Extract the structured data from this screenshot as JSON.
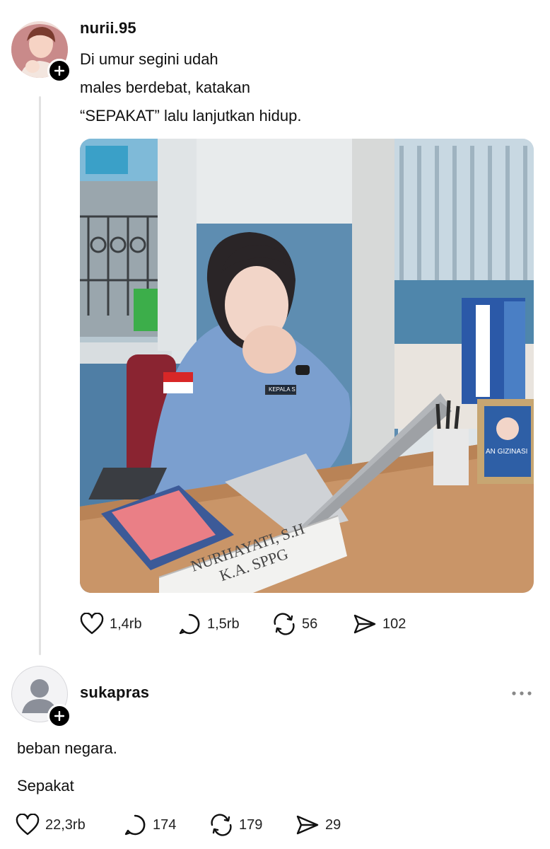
{
  "post": {
    "username": "nurii.95",
    "text_lines": [
      "Di umur segini udah",
      "males berdebat, katakan",
      "“SEPAKAT” lalu lanjutkan hidup."
    ],
    "image": {
      "nameplate_line1": "NURHAYATI, S.H",
      "nameplate_line2": "K.A. SPPG",
      "badge_text": "KEPALA S",
      "frame_text": "AN GIZINASI"
    },
    "stats": {
      "likes": "1,4rb",
      "replies": "1,5rb",
      "reposts": "56",
      "shares": "102"
    }
  },
  "reply": {
    "username": "sukapras",
    "line1": "beban negara.",
    "line2": "Sepakat",
    "stats": {
      "likes": "22,3rb",
      "replies": "174",
      "reposts": "179",
      "shares": "29"
    }
  },
  "colors": {
    "follow_badge": "#000000",
    "thread_line": "#e2e2e2",
    "text": "#111111"
  },
  "icons": [
    "heart-icon",
    "comment-icon",
    "repost-icon",
    "share-icon",
    "more-icon",
    "plus-icon"
  ]
}
